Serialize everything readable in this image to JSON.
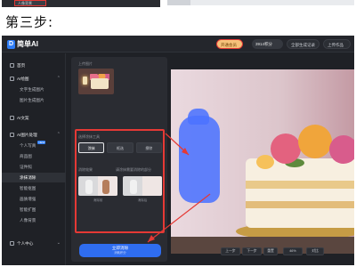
{
  "step_label": "第三步:",
  "previous": {
    "item_label": "人像背景"
  },
  "header": {
    "logo_mark": "D",
    "logo_text": "简单AI",
    "open_pill": "开通会员",
    "points_pill": "3914积分",
    "generated_pill": "全部生成记录",
    "upload_pill": "上传作品"
  },
  "sidebar": {
    "items": [
      {
        "label": "首页",
        "type": "group"
      },
      {
        "label": "AI绘图",
        "type": "group"
      },
      {
        "label": "文字生成图片",
        "type": "sub"
      },
      {
        "label": "图片生成图片",
        "type": "sub"
      },
      {
        "label": "AI文案",
        "type": "group"
      },
      {
        "label": "AI图片处理",
        "type": "group"
      },
      {
        "label": "个人写真",
        "type": "sub",
        "badge": "NEW"
      },
      {
        "label": "商品图",
        "type": "sub"
      },
      {
        "label": "证件照",
        "type": "sub"
      },
      {
        "label": "涂抹消除",
        "type": "sub",
        "active": true
      },
      {
        "label": "智能抠图",
        "type": "sub"
      },
      {
        "label": "画质增强",
        "type": "sub"
      },
      {
        "label": "智能扩图",
        "type": "sub"
      },
      {
        "label": "人像背景",
        "type": "sub"
      },
      {
        "label": "个人中心",
        "type": "group"
      }
    ]
  },
  "panel": {
    "upload_label": "上传图片",
    "section_label": "选择涂抹工具",
    "options": [
      "涂抹",
      "框选",
      "擦除"
    ],
    "effects_label": "消除效果",
    "effects_hint": "请涂抹需要消除的部分",
    "samples": [
      "消除前",
      "消除后"
    ],
    "generate_label": "立即消除",
    "generate_cost": "消耗积分"
  },
  "toolbar": {
    "undo": "上一步",
    "redo": "下一步",
    "reset": "重置",
    "zoom": "46%",
    "compare": "对比"
  },
  "colors": {
    "accent": "#2f6df0",
    "highlight": "#e53935",
    "mask": "#4c73ff"
  }
}
